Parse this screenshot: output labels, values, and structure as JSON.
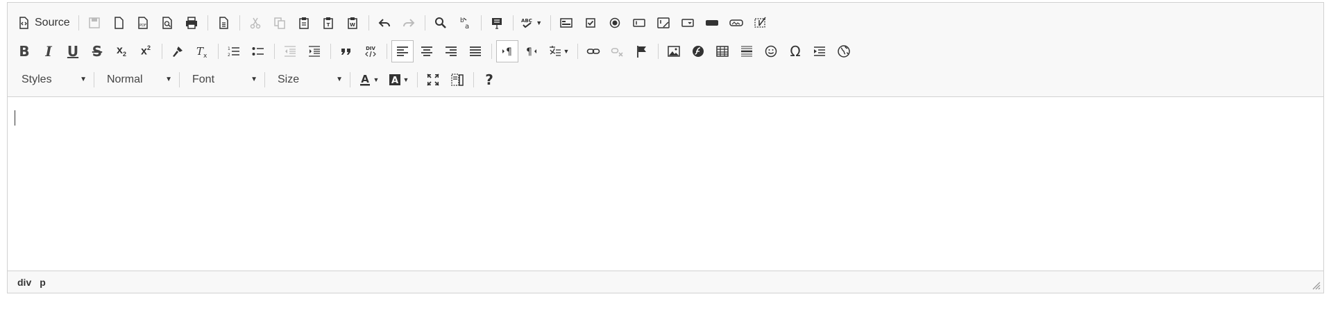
{
  "toolbar": {
    "source_label": "Source",
    "styles_label": "Styles",
    "format_label": "Normal",
    "font_label": "Font",
    "size_label": "Size"
  },
  "statusbar": {
    "path": [
      "div",
      "p"
    ]
  }
}
